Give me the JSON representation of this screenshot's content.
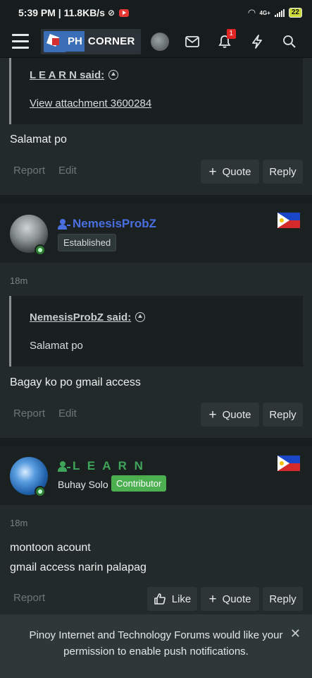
{
  "status_bar": {
    "time_speed": "5:39 PM | 11.8KB/s",
    "network": "4G+",
    "battery": "22"
  },
  "header": {
    "logo_ph": "PH",
    "logo_corner": "CORNER",
    "notification_count": "1"
  },
  "posts": [
    {
      "quote_author": "L E A R N said:",
      "quote_body": "View attachment 3600284",
      "message": "Salamat po",
      "report_label": "Report",
      "edit_label": "Edit",
      "quote_label": "Quote",
      "reply_label": "Reply"
    },
    {
      "username": "NemesisProbZ",
      "user_color": "#4a6fe0",
      "rank": "Established",
      "time": "18m",
      "quote_author": "NemesisProbZ said:",
      "quote_body": "Salamat po",
      "message": "Bagay ko po gmail access",
      "report_label": "Report",
      "edit_label": "Edit",
      "quote_label": "Quote",
      "reply_label": "Reply"
    },
    {
      "username": "L E A R N",
      "user_color": "#3ea65a",
      "title": "Buhay Solo",
      "rank": "Contributor",
      "time": "18m",
      "message_lines": [
        "montoon acount",
        "gmail access narin palapag"
      ],
      "report_label": "Report",
      "like_label": "Like",
      "quote_label": "Quote",
      "reply_label": "Reply"
    }
  ],
  "notification_banner": {
    "text": "Pinoy Internet and Technology Forums would like your permission to enable push notifications."
  }
}
